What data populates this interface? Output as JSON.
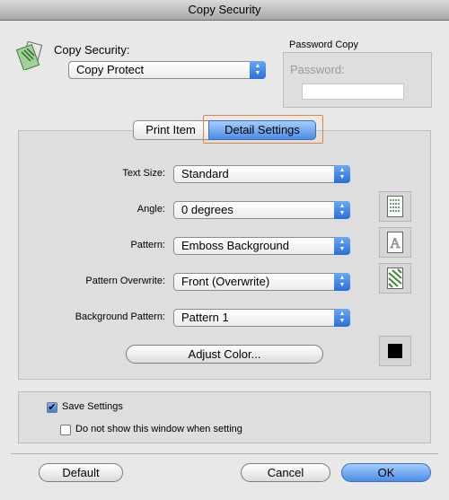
{
  "window": {
    "title": "Copy Security"
  },
  "copy_security": {
    "label": "Copy Security:",
    "value": "Copy Protect"
  },
  "password_copy": {
    "group_title": "Password Copy",
    "password_label": "Password:",
    "password_value": ""
  },
  "tabs": [
    {
      "label": "Print Item"
    },
    {
      "label": "Detail Settings"
    }
  ],
  "settings": {
    "text_size_label": "Text Size:",
    "text_size_value": "Standard",
    "angle_label": "Angle:",
    "angle_value": "0 degrees",
    "pattern_label": "Pattern:",
    "pattern_value": "Emboss Background",
    "overwrite_label": "Pattern Overwrite:",
    "overwrite_value": "Front (Overwrite)",
    "bg_pattern_label": "Background Pattern:",
    "bg_pattern_value": "Pattern 1",
    "adjust_color_label": "Adjust Color..."
  },
  "options": {
    "save_settings_label": "Save Settings",
    "save_settings_checked": true,
    "dont_show_label": "Do not show this window when setting",
    "dont_show_checked": false
  },
  "buttons": {
    "default_label": "Default",
    "cancel_label": "Cancel",
    "ok_label": "OK"
  },
  "colors": {
    "accent": "#3d7fe0",
    "focus_ring": "#e8823a",
    "swatch": "#000000"
  }
}
